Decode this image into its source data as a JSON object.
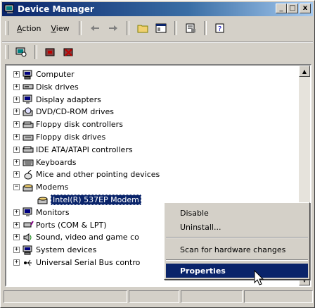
{
  "window": {
    "title": "Device Manager"
  },
  "caption_buttons": {
    "minimize": "_",
    "maximize": "□",
    "close": "x"
  },
  "menu": [
    {
      "label": "Action",
      "underline": "A",
      "rest": "ction"
    },
    {
      "label": "View",
      "underline": "V",
      "rest": "iew"
    }
  ],
  "tree": {
    "items": [
      {
        "label": "Computer",
        "icon": "computer-icon",
        "expander": "+"
      },
      {
        "label": "Disk drives",
        "icon": "disk-drive-icon",
        "expander": "+"
      },
      {
        "label": "Display adapters",
        "icon": "monitor-icon",
        "expander": "+"
      },
      {
        "label": "DVD/CD-ROM drives",
        "icon": "cdrom-icon",
        "expander": "+"
      },
      {
        "label": "Floppy disk controllers",
        "icon": "controller-icon",
        "expander": "+"
      },
      {
        "label": "Floppy disk drives",
        "icon": "floppy-drive-icon",
        "expander": "+"
      },
      {
        "label": "IDE ATA/ATAPI controllers",
        "icon": "controller-icon",
        "expander": "+"
      },
      {
        "label": "Keyboards",
        "icon": "keyboard-icon",
        "expander": "+"
      },
      {
        "label": "Mice and other pointing devices",
        "icon": "mouse-icon",
        "expander": "+"
      },
      {
        "label": "Modems",
        "icon": "modem-icon",
        "expander": "−"
      },
      {
        "label": "Intel(R) 537EP Modem",
        "icon": "modem-icon",
        "expander": ""
      },
      {
        "label": "Monitors",
        "icon": "monitor-icon",
        "expander": "+"
      },
      {
        "label": "Ports (COM & LPT)",
        "icon": "port-icon",
        "expander": "+"
      },
      {
        "label": "Sound, video and game co",
        "icon": "speaker-icon",
        "expander": "+"
      },
      {
        "label": "System devices",
        "icon": "computer-icon",
        "expander": "+"
      },
      {
        "label": "Universal Serial Bus contro",
        "icon": "usb-icon",
        "expander": "+"
      }
    ]
  },
  "context_menu": {
    "disable": "Disable",
    "uninstall": "Uninstall...",
    "scan": "Scan for hardware changes",
    "properties": "Properties"
  },
  "colors": {
    "selection": "#0a246a",
    "face": "#d4d0c8"
  }
}
